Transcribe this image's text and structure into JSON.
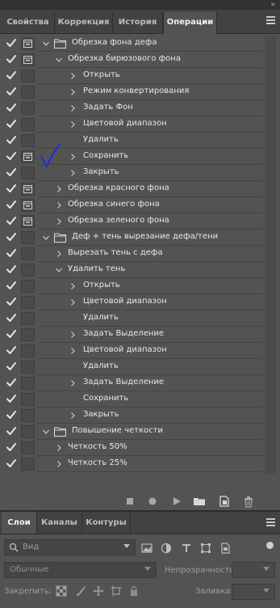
{
  "topbar": {
    "collapse_glyph": "»"
  },
  "tabs": [
    {
      "label": "Свойства"
    },
    {
      "label": "Коррекция"
    },
    {
      "label": "История"
    },
    {
      "label": "Операции"
    }
  ],
  "actions": [
    {
      "label": "Обрезка фона дефа",
      "level": 0,
      "type": "set",
      "expanded": true,
      "dialog": true
    },
    {
      "label": "Обрезка бирюзового фона",
      "level": 1,
      "type": "action",
      "expanded": true,
      "dialog": true
    },
    {
      "label": "Открыть",
      "level": 2,
      "type": "step",
      "expandable": true,
      "dialog": false
    },
    {
      "label": "Режим конвертирования",
      "level": 2,
      "type": "step",
      "expandable": true,
      "dialog": false
    },
    {
      "label": "Задать Фон",
      "level": 2,
      "type": "step",
      "expandable": true,
      "dialog": false
    },
    {
      "label": "Цветовой диапазон",
      "level": 2,
      "type": "step",
      "expandable": true,
      "dialog": false
    },
    {
      "label": "Удалить",
      "level": 2,
      "type": "step",
      "expandable": false,
      "dialog": false
    },
    {
      "label": "Сохранить",
      "level": 2,
      "type": "step",
      "expandable": true,
      "dialog": true
    },
    {
      "label": "Закрыть",
      "level": 2,
      "type": "step",
      "expandable": true,
      "dialog": false
    },
    {
      "label": "Обрезка красного фона",
      "level": 1,
      "type": "action",
      "expanded": false,
      "dialog": true
    },
    {
      "label": "Обрезка синего фона",
      "level": 1,
      "type": "action",
      "expanded": false,
      "dialog": true
    },
    {
      "label": "Обрезка зеленого фона",
      "level": 1,
      "type": "action",
      "expanded": false,
      "dialog": true
    },
    {
      "label": "Деф + тень вырезание дефа/тени",
      "level": 0,
      "type": "set",
      "expanded": true,
      "dialog": false
    },
    {
      "label": "Вырезать тень с дефа",
      "level": 1,
      "type": "action",
      "expanded": false,
      "dialog": false
    },
    {
      "label": "Удалить тень",
      "level": 1,
      "type": "action",
      "expanded": true,
      "dialog": false
    },
    {
      "label": "Открыть",
      "level": 2,
      "type": "step",
      "expandable": true,
      "dialog": false
    },
    {
      "label": "Цветовой диапазон",
      "level": 2,
      "type": "step",
      "expandable": true,
      "dialog": false
    },
    {
      "label": "Удалить",
      "level": 2,
      "type": "step",
      "expandable": false,
      "dialog": false
    },
    {
      "label": "Задать Выделение",
      "level": 2,
      "type": "step",
      "expandable": true,
      "dialog": false
    },
    {
      "label": "Цветовой диапазон",
      "level": 2,
      "type": "step",
      "expandable": true,
      "dialog": false
    },
    {
      "label": "Удалить",
      "level": 2,
      "type": "step",
      "expandable": false,
      "dialog": false
    },
    {
      "label": "Задать Выделение",
      "level": 2,
      "type": "step",
      "expandable": true,
      "dialog": false
    },
    {
      "label": "Сохранить",
      "level": 2,
      "type": "step",
      "expandable": false,
      "dialog": false
    },
    {
      "label": "Закрыть",
      "level": 2,
      "type": "step",
      "expandable": true,
      "dialog": false
    },
    {
      "label": "Повышение четкости",
      "level": 0,
      "type": "set",
      "expanded": true,
      "dialog": false
    },
    {
      "label": "Четкость 50%",
      "level": 1,
      "type": "action",
      "expanded": false,
      "dialog": false
    },
    {
      "label": "Четкость 25%",
      "level": 1,
      "type": "action",
      "expanded": false,
      "dialog": false
    }
  ],
  "action_toolbar": [
    "stop-icon",
    "record-icon",
    "play-icon",
    "new-set-icon",
    "new-action-icon",
    "delete-icon"
  ],
  "layers_tabs": [
    {
      "label": "Слои"
    },
    {
      "label": "Каналы"
    },
    {
      "label": "Контуры"
    }
  ],
  "layers": {
    "kind_filter": "Вид",
    "blend_mode": "Обычные",
    "opacity_label": "Непрозрачность:",
    "lock_label": "Закрепить:",
    "fill_label": "Заливка:"
  },
  "colors": {
    "panel_bg": "#535353",
    "tab_bar": "#424242",
    "check": "#e6e6e6",
    "annotation_mark": "#1a2fd6"
  }
}
